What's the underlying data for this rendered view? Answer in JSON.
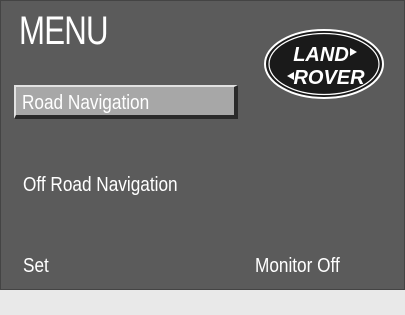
{
  "menu": {
    "title": "MENU",
    "road_navigation": "Road Navigation",
    "off_road_navigation": "Off Road Navigation",
    "set": "Set",
    "monitor_off": "Monitor Off"
  },
  "logo": {
    "line1": "LAND",
    "line2": "ROVER"
  },
  "colors": {
    "screen_bg": "#5b5b5b",
    "selected_bg": "#a7a7a7",
    "text": "#ffffff",
    "logo_fill": "#1a1a1a"
  }
}
